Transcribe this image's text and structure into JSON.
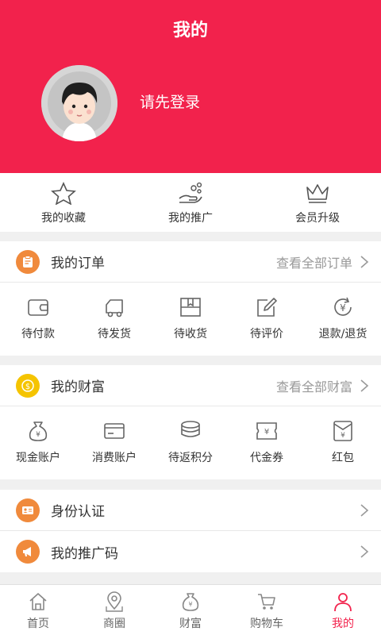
{
  "header": {
    "title": "我的",
    "login_prompt": "请先登录"
  },
  "quick": [
    {
      "label": "我的收藏",
      "icon": "star-icon"
    },
    {
      "label": "我的推广",
      "icon": "share-hand-icon"
    },
    {
      "label": "会员升级",
      "icon": "crown-icon"
    }
  ],
  "orders": {
    "title": "我的订单",
    "link": "查看全部订单",
    "items": [
      "待付款",
      "待发货",
      "待收货",
      "待评价",
      "退款/退货"
    ]
  },
  "wealth": {
    "title": "我的财富",
    "link": "查看全部财富",
    "items": [
      "现金账户",
      "消费账户",
      "待返积分",
      "代金券",
      "红包"
    ]
  },
  "identity": {
    "title": "身份认证"
  },
  "promo_code": {
    "title": "我的推广码"
  },
  "tabbar": {
    "items": [
      "首页",
      "商圈",
      "财富",
      "购物车",
      "我的"
    ],
    "active": "我的"
  },
  "colors": {
    "brand": "#f2224c",
    "orange": "#f08a3c",
    "gold": "#f5c400"
  }
}
